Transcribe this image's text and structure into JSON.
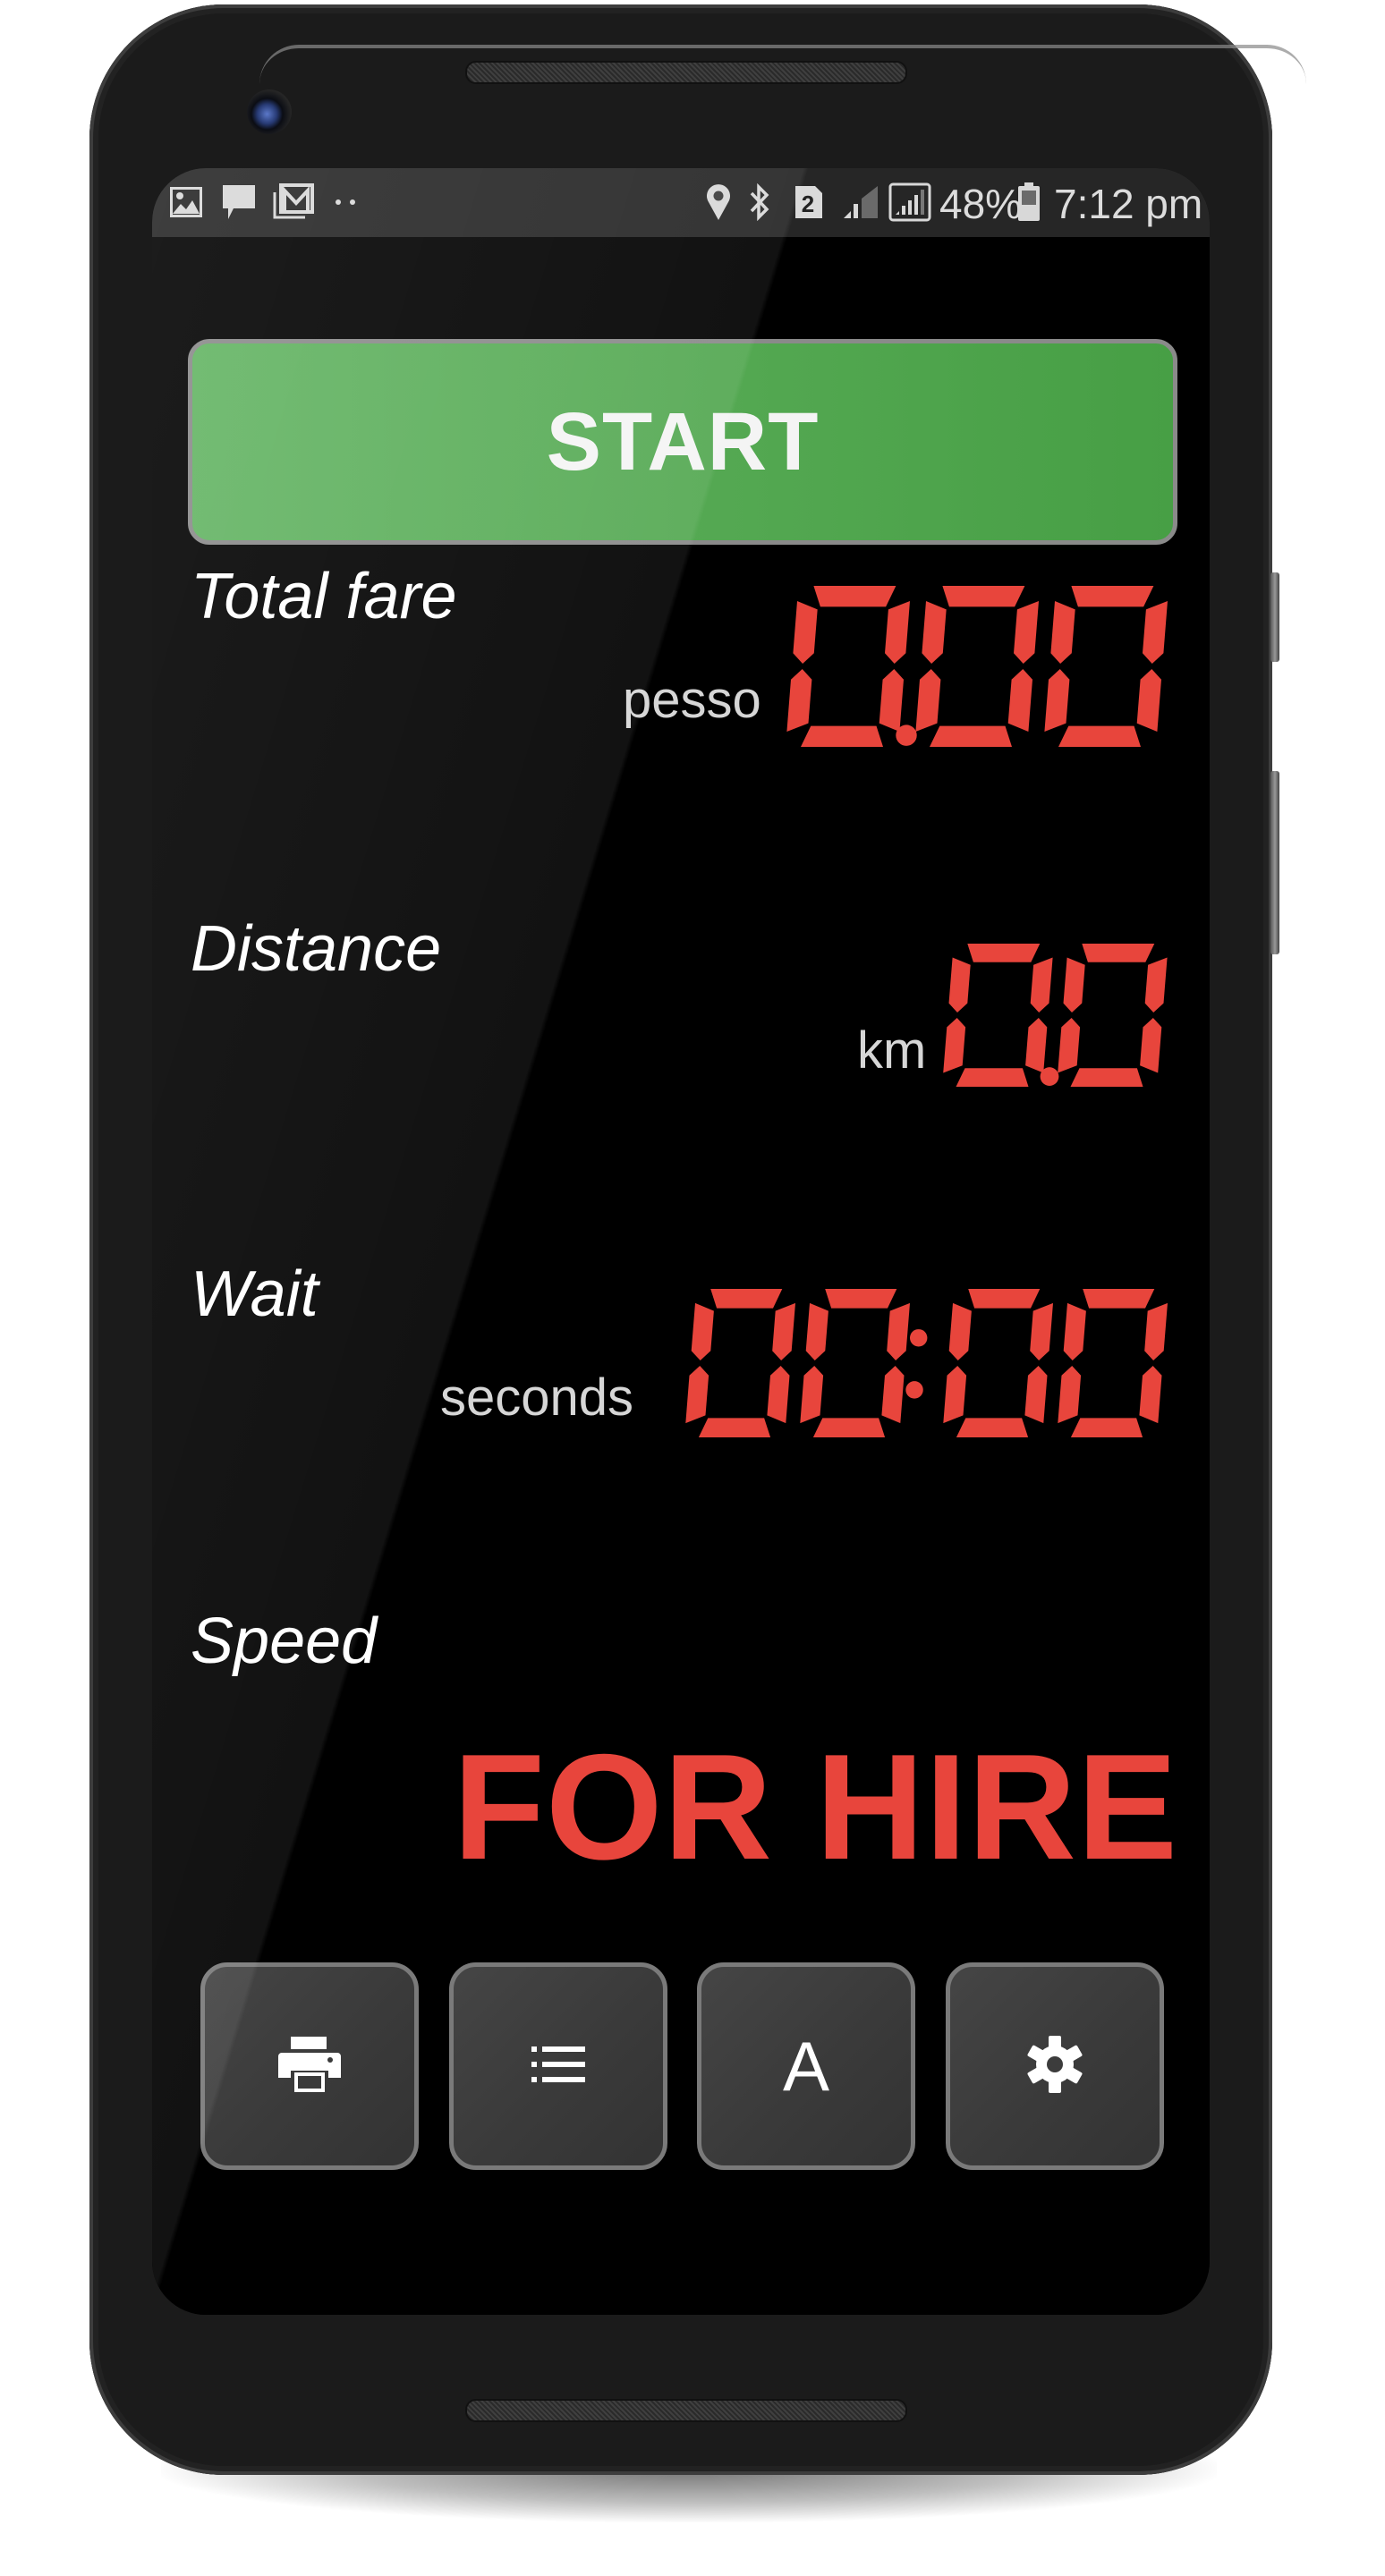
{
  "status_bar": {
    "left_icons": [
      "image-icon",
      "message-icon",
      "gmail-icon",
      "more-dots-icon"
    ],
    "right_icons": [
      "location-icon",
      "bluetooth-icon",
      "sim-2-icon",
      "signal-icon",
      "signal-boxed-icon",
      "battery-icon"
    ],
    "sim_label": "2",
    "battery": "48%",
    "time": "7:12 pm"
  },
  "start_button": {
    "label": "START",
    "color": "#55a953"
  },
  "fare": {
    "label": "Total fare",
    "unit": "pesso",
    "value": "0.00"
  },
  "distance": {
    "label": "Distance",
    "unit": "km",
    "value": "0.0"
  },
  "wait": {
    "label": "Wait",
    "unit": "seconds",
    "value": "00:00"
  },
  "speed": {
    "label": "Speed",
    "status": "FOR HIRE"
  },
  "toolbar": {
    "buttons": [
      {
        "name": "print-button",
        "icon": "printer-icon"
      },
      {
        "name": "list-button",
        "icon": "list-icon"
      },
      {
        "name": "font-button",
        "icon": "font-icon",
        "label": "A"
      },
      {
        "name": "settings-button",
        "icon": "gear-icon"
      }
    ]
  },
  "colors": {
    "segment": "#e8453c",
    "background": "#000000",
    "label": "#ffffff"
  }
}
